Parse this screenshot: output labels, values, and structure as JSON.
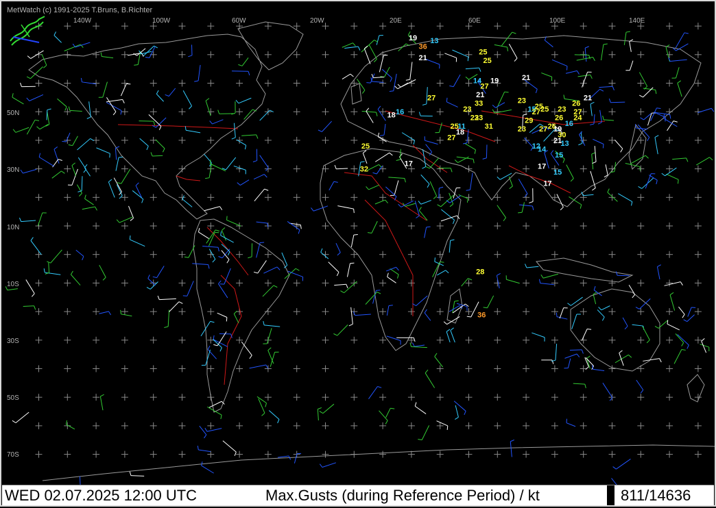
{
  "copyright": "MetWatch  (c) 1991-2025 T.Bruns, B.Richter",
  "status_bar": {
    "datetime": "WED 02.07.2025 12:00 UTC",
    "parameter": "Max.Gusts (during Reference Period) / kt",
    "station_count": "811/14636"
  },
  "axes": {
    "longitude_labels": [
      "140W",
      "100W",
      "60W",
      "20W",
      "20E",
      "60E",
      "100E",
      "140E"
    ],
    "latitude_labels": [
      "50N",
      "30N",
      "10N",
      "10S",
      "30S",
      "50S",
      "70S"
    ]
  },
  "colors": {
    "background": "#000000",
    "coastline": "#9a9a9a",
    "borders": "#d01818",
    "grid": "#8a8a8a",
    "gust_white": "#ffffff",
    "gust_yellow": "#ffff33",
    "gust_cyan": "#33ccff",
    "gust_orange": "#ff9a2a"
  },
  "gust_reports": [
    {
      "value": "19",
      "color": "white",
      "lon": 11,
      "lat": 66
    },
    {
      "value": "13",
      "color": "cyan",
      "lon": 26,
      "lat": 65
    },
    {
      "value": "36",
      "color": "orange",
      "lon": 18,
      "lat": 63
    },
    {
      "value": "25",
      "color": "yellow",
      "lon": 60,
      "lat": 61
    },
    {
      "value": "25",
      "color": "yellow",
      "lon": 63,
      "lat": 58
    },
    {
      "value": "21",
      "color": "white",
      "lon": 18,
      "lat": 59
    },
    {
      "value": "14",
      "color": "cyan",
      "lon": 56,
      "lat": 51
    },
    {
      "value": "27",
      "color": "yellow",
      "lon": 61,
      "lat": 49
    },
    {
      "value": "19",
      "color": "white",
      "lon": 68,
      "lat": 51
    },
    {
      "value": "21",
      "color": "white",
      "lon": 90,
      "lat": 52
    },
    {
      "value": "21",
      "color": "white",
      "lon": 58,
      "lat": 46
    },
    {
      "value": "27",
      "color": "yellow",
      "lon": 24,
      "lat": 45
    },
    {
      "value": "33",
      "color": "yellow",
      "lon": 57,
      "lat": 43
    },
    {
      "value": "23",
      "color": "yellow",
      "lon": 87,
      "lat": 44
    },
    {
      "value": "15",
      "color": "cyan",
      "lon": 94,
      "lat": 41
    },
    {
      "value": "25",
      "color": "yellow",
      "lon": 99,
      "lat": 42
    },
    {
      "value": "25",
      "color": "yellow",
      "lon": 103,
      "lat": 41
    },
    {
      "value": "27",
      "color": "yellow",
      "lon": 97,
      "lat": 40
    },
    {
      "value": "23",
      "color": "yellow",
      "lon": 115,
      "lat": 41
    },
    {
      "value": "26",
      "color": "yellow",
      "lon": 125,
      "lat": 43
    },
    {
      "value": "27",
      "color": "yellow",
      "lon": 126,
      "lat": 40
    },
    {
      "value": "24",
      "color": "yellow",
      "lon": 126,
      "lat": 38
    },
    {
      "value": "21",
      "color": "white",
      "lon": 133,
      "lat": 45
    },
    {
      "value": "23",
      "color": "yellow",
      "lon": 49,
      "lat": 41
    },
    {
      "value": "23",
      "color": "yellow",
      "lon": 54,
      "lat": 38
    },
    {
      "value": "23",
      "color": "yellow",
      "lon": 57,
      "lat": 38
    },
    {
      "value": "18",
      "color": "white",
      "lon": -4,
      "lat": 39
    },
    {
      "value": "16",
      "color": "cyan",
      "lon": 2,
      "lat": 40
    },
    {
      "value": "26",
      "color": "yellow",
      "lon": 113,
      "lat": 38
    },
    {
      "value": "29",
      "color": "yellow",
      "lon": 92,
      "lat": 37
    },
    {
      "value": "16",
      "color": "cyan",
      "lon": 120,
      "lat": 36
    },
    {
      "value": "11",
      "color": "cyan",
      "lon": 45,
      "lat": 35
    },
    {
      "value": "25",
      "color": "yellow",
      "lon": 40,
      "lat": 35
    },
    {
      "value": "31",
      "color": "yellow",
      "lon": 64,
      "lat": 35
    },
    {
      "value": "18",
      "color": "white",
      "lon": 44,
      "lat": 33
    },
    {
      "value": "23",
      "color": "yellow",
      "lon": 87,
      "lat": 34
    },
    {
      "value": "27",
      "color": "yellow",
      "lon": 102,
      "lat": 34
    },
    {
      "value": "26",
      "color": "yellow",
      "lon": 108,
      "lat": 35
    },
    {
      "value": "19",
      "color": "white",
      "lon": 112,
      "lat": 34
    },
    {
      "value": "30",
      "color": "yellow",
      "lon": 115,
      "lat": 32
    },
    {
      "value": "27",
      "color": "yellow",
      "lon": 38,
      "lat": 31
    },
    {
      "value": "21",
      "color": "white",
      "lon": 112,
      "lat": 30
    },
    {
      "value": "13",
      "color": "cyan",
      "lon": 117,
      "lat": 29
    },
    {
      "value": "25",
      "color": "yellow",
      "lon": -22,
      "lat": 28
    },
    {
      "value": "12",
      "color": "cyan",
      "lon": 97,
      "lat": 28
    },
    {
      "value": "14",
      "color": "cyan",
      "lon": 101,
      "lat": 27
    },
    {
      "value": "15",
      "color": "cyan",
      "lon": 113,
      "lat": 25
    },
    {
      "value": "17",
      "color": "white",
      "lon": 8,
      "lat": 22
    },
    {
      "value": "17",
      "color": "white",
      "lon": 101,
      "lat": 21
    },
    {
      "value": "15",
      "color": "cyan",
      "lon": 112,
      "lat": 19
    },
    {
      "value": "32",
      "color": "yellow",
      "lon": -23,
      "lat": 20
    },
    {
      "value": "17",
      "color": "white",
      "lon": 105,
      "lat": 15
    },
    {
      "value": "28",
      "color": "yellow",
      "lon": 58,
      "lat": -16
    },
    {
      "value": "36",
      "color": "orange",
      "lon": 59,
      "lat": -31
    }
  ]
}
